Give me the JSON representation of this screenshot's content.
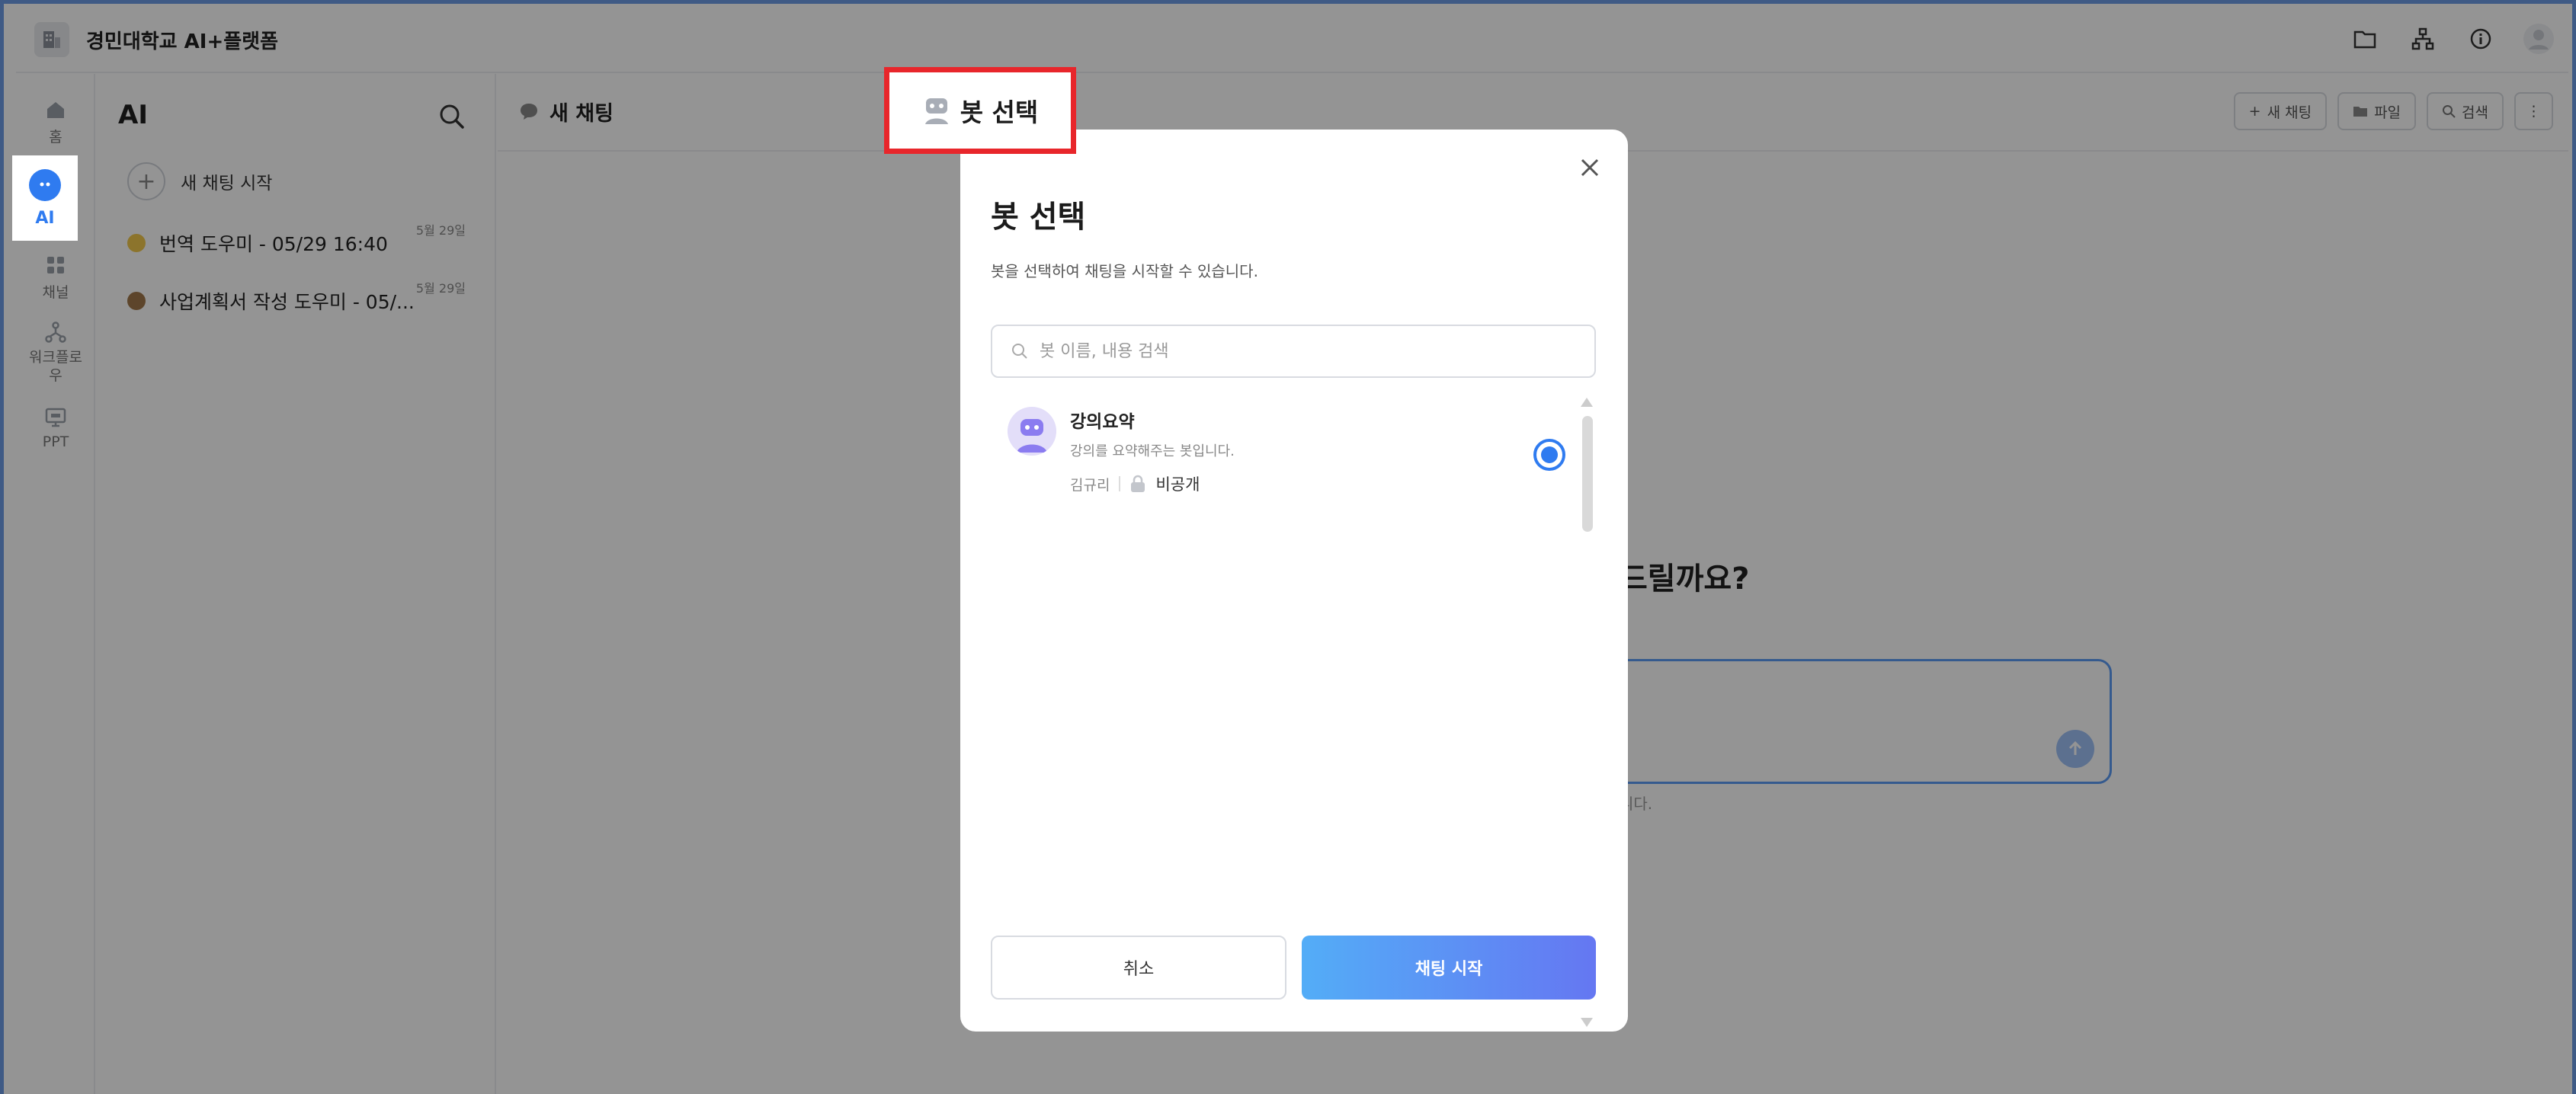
{
  "app": {
    "title": "경민대학교 AI+플랫폼"
  },
  "rail": {
    "items": [
      {
        "label": "홈",
        "icon": "home-icon"
      },
      {
        "label": "AI",
        "icon": "chat-bubble-icon",
        "active": true
      },
      {
        "label": "채널",
        "icon": "grid-icon"
      },
      {
        "label": "워크플로우",
        "icon": "workflow-icon"
      },
      {
        "label": "PPT",
        "icon": "presentation-icon"
      }
    ]
  },
  "panel": {
    "title": "AI",
    "new_chat_label": "새 채팅 시작",
    "chats": [
      {
        "title": "번역 도우미 - 05/29 16:40",
        "date": "5월 29일",
        "color": "#f2c94c"
      },
      {
        "title": "사업계획서 작성 도우미 - 05/...",
        "date": "5월 29일",
        "color": "#a0784a"
      }
    ]
  },
  "main": {
    "title": "새 채팅",
    "buttons": {
      "new_chat": "새 채팅",
      "files": "파일",
      "search": "검색"
    },
    "welcome_fragment": "드릴까요?",
    "disclaimer_fragment": "니다."
  },
  "modal": {
    "title": "봇 선택",
    "subtitle": "봇을 선택하여 채팅을 시작할 수 있습니다.",
    "search_placeholder": "봇 이름, 내용 검색",
    "bots": [
      {
        "name": "강의요약",
        "description": "강의를 요약해주는 봇입니다.",
        "owner": "김규리",
        "visibility": "비공개",
        "selected": true
      }
    ],
    "cancel_label": "취소",
    "start_label": "채팅 시작"
  },
  "callout": {
    "label": "봇 선택"
  },
  "colors": {
    "accent": "#2f7bf0",
    "callout_border": "#e8262b",
    "gradient_start": "#53adf7",
    "gradient_end": "#6577f2"
  }
}
